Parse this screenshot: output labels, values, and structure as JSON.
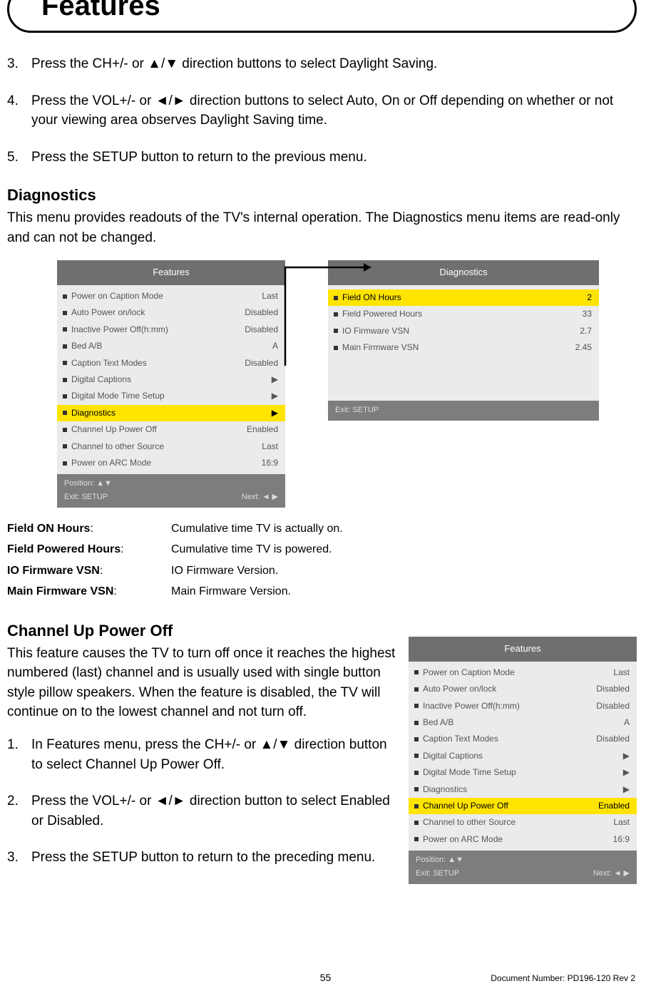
{
  "page_title": "Features",
  "steps_top": [
    {
      "n": "3.",
      "t": "Press the CH+/- or ▲/▼ direction buttons to select Daylight Saving."
    },
    {
      "n": "4.",
      "t": "Press the VOL+/- or ◄/► direction buttons to select Auto, On or Off depending on whether or not your viewing area observes Daylight Saving time."
    },
    {
      "n": "5.",
      "t": "Press the SETUP button to return to the previous menu."
    }
  ],
  "diag_heading": "Diagnostics",
  "diag_para": "This menu provides readouts of the TV's internal operation. The Diagnostics menu items are read-only and can not be changed.",
  "features_menu": {
    "title": "Features",
    "items": [
      {
        "label": "Power on Caption Mode",
        "value": "Last"
      },
      {
        "label": "Auto Power on/lock",
        "value": "Disabled"
      },
      {
        "label": "Inactive Power Off(h:mm)",
        "value": "Disabled"
      },
      {
        "label": "Bed A/B",
        "value": "A"
      },
      {
        "label": "Caption Text Modes",
        "value": "Disabled"
      },
      {
        "label": "Digital Captions",
        "value": "▶"
      },
      {
        "label": "Digital Mode Time Setup",
        "value": "▶"
      },
      {
        "label": "Diagnostics",
        "value": "▶",
        "hl": true
      },
      {
        "label": "Channel Up Power Off",
        "value": "Enabled"
      },
      {
        "label": "Channel to other Source",
        "value": "Last"
      },
      {
        "label": "Power on ARC Mode",
        "value": "16:9"
      }
    ],
    "footer": {
      "pos": "Position: ▲▼",
      "exit": "Exit: SETUP",
      "next": "Next: ◄ ▶"
    }
  },
  "diag_menu": {
    "title": "Diagnostics",
    "items": [
      {
        "label": "Field ON Hours",
        "value": "2",
        "hl": true
      },
      {
        "label": "Field Powered Hours",
        "value": "33"
      },
      {
        "label": "IO Firmware VSN",
        "value": "2.7"
      },
      {
        "label": "Main Firmware VSN",
        "value": "2.45"
      }
    ],
    "footer": {
      "exit": "Exit: SETUP"
    }
  },
  "defs": [
    {
      "term": "Field ON Hours",
      "desc": "Cumulative time TV is actually on."
    },
    {
      "term": "Field Powered Hours",
      "desc": "Cumulative time TV is powered."
    },
    {
      "term": "IO Firmware VSN",
      "desc": "IO Firmware Version."
    },
    {
      "term": "Main Firmware VSN",
      "desc": "Main Firmware Version."
    }
  ],
  "cup_heading": "Channel Up Power Off",
  "cup_para": "This feature causes the TV to turn off once it reaches the highest numbered (last) channel and is usually used with single button style pillow speakers. When the feature is disabled, the TV will continue on to the lowest channel and not turn off.",
  "cup_steps": [
    {
      "n": "1.",
      "t": "In Features menu, press the CH+/- or ▲/▼ direction button to select Channel Up Power Off."
    },
    {
      "n": "2.",
      "t": "Press the VOL+/- or ◄/► direction button to select Enabled or Disabled."
    },
    {
      "n": "3.",
      "t": "Press the SETUP button to return to the preceding menu."
    }
  ],
  "features_menu2": {
    "title": "Features",
    "items": [
      {
        "label": "Power on Caption Mode",
        "value": "Last"
      },
      {
        "label": "Auto Power on/lock",
        "value": "Disabled"
      },
      {
        "label": "Inactive Power Off(h:mm)",
        "value": "Disabled"
      },
      {
        "label": "Bed A/B",
        "value": "A"
      },
      {
        "label": "Caption Text Modes",
        "value": "Disabled"
      },
      {
        "label": "Digital Captions",
        "value": "▶"
      },
      {
        "label": "Digital Mode Time Setup",
        "value": "▶"
      },
      {
        "label": "Diagnostics",
        "value": "▶"
      },
      {
        "label": "Channel Up Power Off",
        "value": "Enabled",
        "hl": true
      },
      {
        "label": "Channel to other Source",
        "value": "Last"
      },
      {
        "label": "Power on ARC Mode",
        "value": "16:9"
      }
    ],
    "footer": {
      "pos": "Position: ▲▼",
      "exit": "Exit: SETUP",
      "next": "Next: ◄ ▶"
    }
  },
  "page_number": "55",
  "doc_number": "Document Number: PD196-120 Rev 2"
}
